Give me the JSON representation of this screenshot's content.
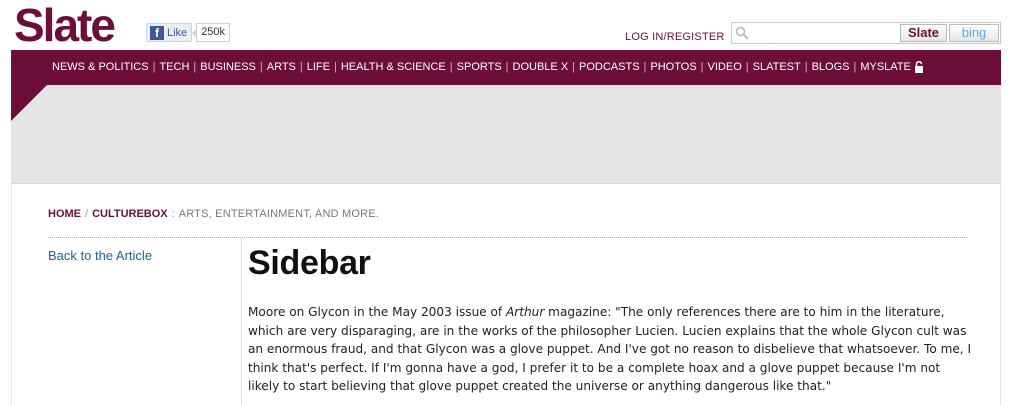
{
  "header": {
    "logo": "Slate",
    "facebook": {
      "like_label": "Like",
      "count": "250k"
    },
    "login_label": "LOG IN/REGISTER",
    "search": {
      "placeholder": "",
      "slate_button": "Slate",
      "bing_button": "bing"
    }
  },
  "nav": {
    "items": [
      "NEWS & POLITICS",
      "TECH",
      "BUSINESS",
      "ARTS",
      "LIFE",
      "HEALTH & SCIENCE",
      "SPORTS",
      "DOUBLE X",
      "PODCASTS",
      "PHOTOS",
      "VIDEO",
      "SLATEST",
      "BLOGS",
      "MYSLATE"
    ],
    "separator": "|"
  },
  "breadcrumb": {
    "home": "HOME",
    "section": "CULTUREBOX",
    "slash": "/",
    "colon": ":",
    "description": "ARTS, ENTERTAINMENT, AND MORE."
  },
  "sidebar": {
    "back_link": "Back to the Article"
  },
  "article": {
    "title": "Sidebar",
    "body_before": "Moore on Glycon in the May 2003 issue of ",
    "body_italic": "Arthur",
    "body_after": " magazine: \"The only references there are to him in the literature, which are very disparaging, are in the works of the philosopher Lucien. Lucien explains that the whole Glycon cult was an enormous fraud, and that Glycon was a glove puppet. And I've got no reason to disbelieve that whatsoever. To me, I think that's perfect. If I'm gonna have a god, I prefer it to be a complete hoax and a glove puppet because I'm not likely to start believing that glove puppet created the universe or anything dangerous like that.\""
  },
  "colors": {
    "brand": "#6b0f3a",
    "link": "#1a6496",
    "ad_band": "#e5e5e5"
  },
  "icons": {
    "search": "search-icon",
    "lock": "lock-icon",
    "facebook": "facebook-icon"
  }
}
